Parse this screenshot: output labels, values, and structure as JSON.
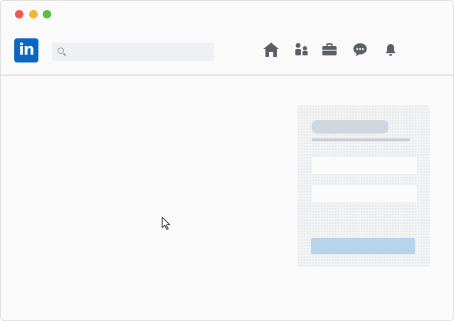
{
  "window": {
    "controls": [
      "close",
      "minimize",
      "maximize"
    ]
  },
  "header": {
    "logo_text": "in",
    "search": {
      "placeholder": "",
      "value": ""
    },
    "nav_icons": [
      "home-icon",
      "network-icon",
      "jobs-briefcase-icon",
      "messaging-icon",
      "notifications-bell-icon"
    ]
  },
  "login_card": {
    "field_1_value": "",
    "field_2_value": "",
    "submit_label": ""
  },
  "colors": {
    "brand": "#0a66c2",
    "icon": "#5a5f66",
    "skeleton": "#cfd6dd",
    "button": "#b6d5ea"
  }
}
